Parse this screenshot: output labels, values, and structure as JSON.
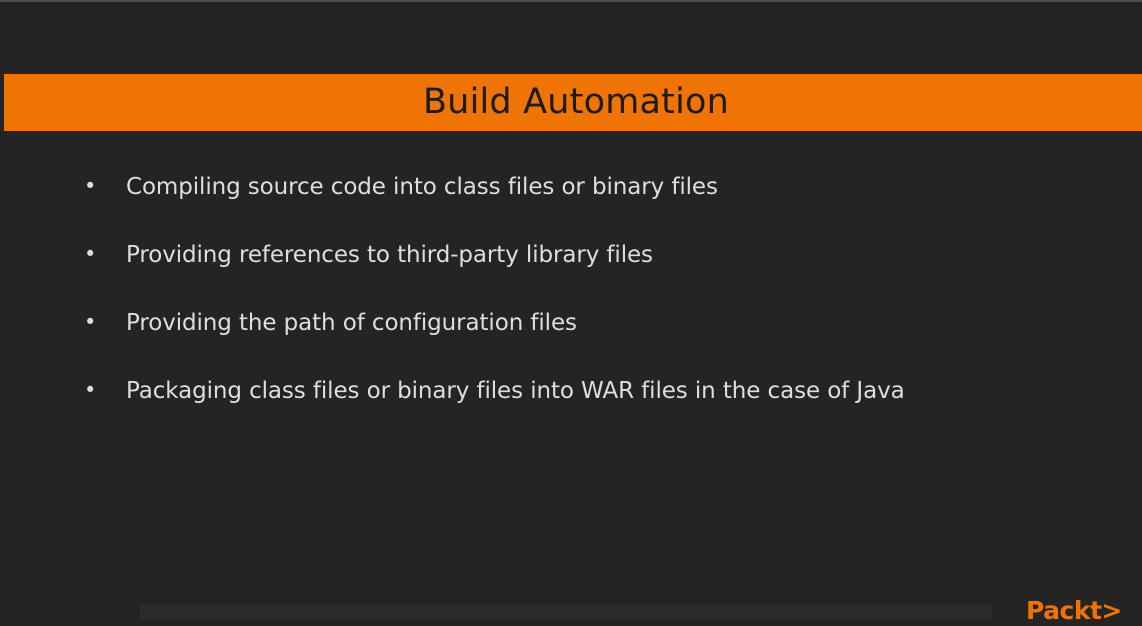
{
  "slide": {
    "title": "Build Automation",
    "bullets": [
      "Compiling source code into class files or binary files",
      "Providing references to third-party library files",
      "Providing the path of configuration files",
      "Packaging class files or binary files into WAR files in the case of Java"
    ],
    "bullet_symbol": "•"
  },
  "brand": {
    "logo_text": "Packt>"
  },
  "colors": {
    "accent": "#f07305",
    "background": "#242424",
    "text": "#dedede",
    "title_text": "#1c1c1c"
  }
}
